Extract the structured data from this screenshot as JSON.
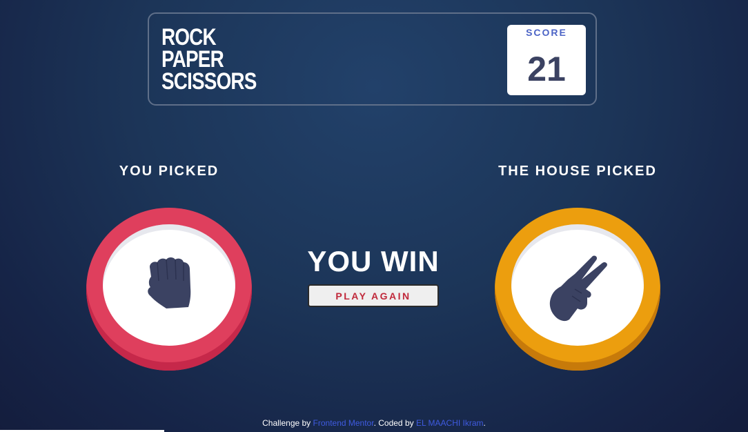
{
  "header": {
    "title_lines": [
      "ROCK",
      "PAPER",
      "SCISSORS"
    ],
    "score_label": "SCORE",
    "score_value": "21"
  },
  "player": {
    "label": "YOU PICKED",
    "choice": "rock",
    "icon": "rock-icon",
    "color": "#df3f5d"
  },
  "house": {
    "label": "THE HOUSE PICKED",
    "choice": "scissors",
    "icon": "scissors-icon",
    "color": "#ec9e0e"
  },
  "result": {
    "text": "YOU WIN",
    "play_again_label": "PLAY AGAIN"
  },
  "footer": {
    "prefix": "Challenge by ",
    "mentor_link": "Frontend Mentor",
    "middle": ". Coded by ",
    "author_link": "EL MAACHI Ikram",
    "suffix": "."
  }
}
